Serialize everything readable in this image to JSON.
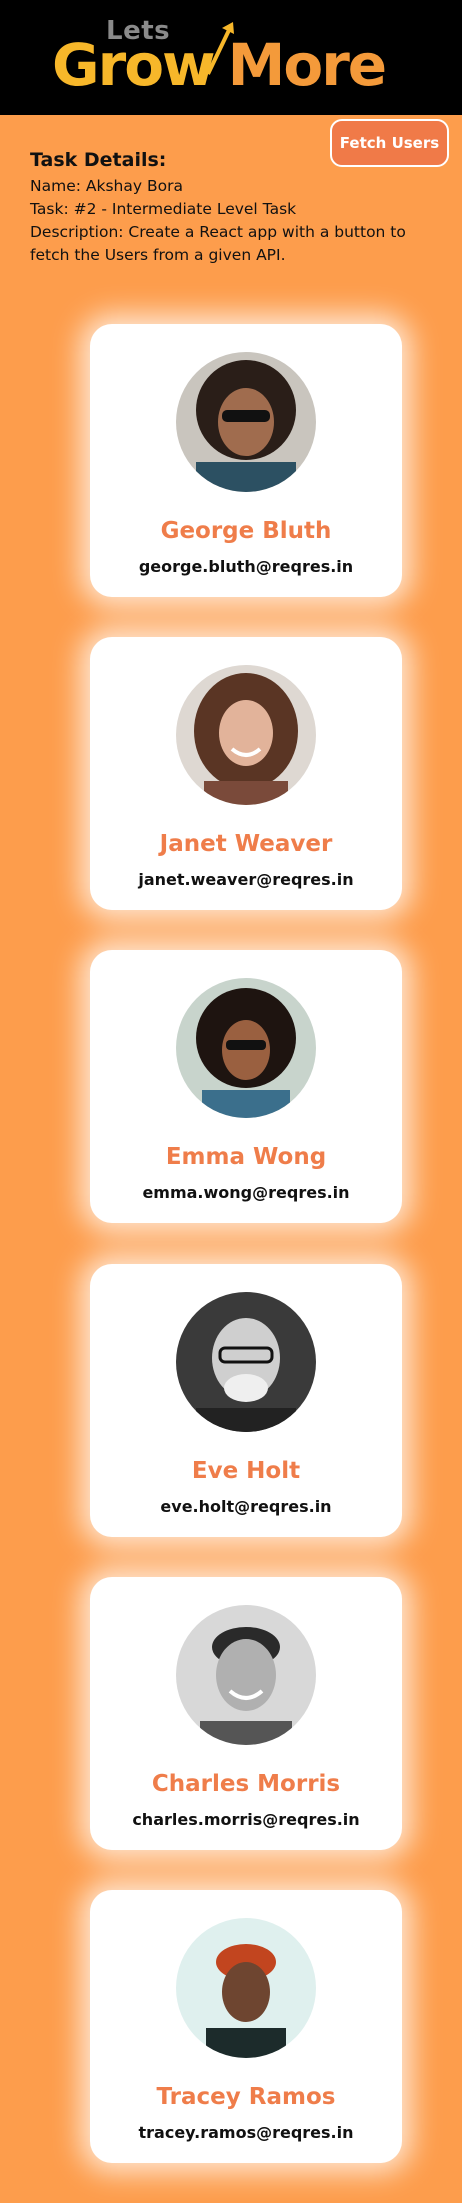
{
  "header": {
    "logo": {
      "small_word": "Lets",
      "big_word_1": "Grow",
      "big_word_2": "More"
    }
  },
  "fetch_button": {
    "label": "Fetch Users"
  },
  "task": {
    "heading": "Task Details:",
    "name_line": "Name: Akshay Bora",
    "task_line": "Task: #2 - Intermediate Level Task",
    "description_line": "Description: Create a React app with a button to fetch the Users from a given API."
  },
  "users": [
    {
      "name": "George Bluth",
      "email": "george.bluth@reqres.in"
    },
    {
      "name": "Janet Weaver",
      "email": "janet.weaver@reqres.in"
    },
    {
      "name": "Emma Wong",
      "email": "emma.wong@reqres.in"
    },
    {
      "name": "Eve Holt",
      "email": "eve.holt@reqres.in"
    },
    {
      "name": "Charles Morris",
      "email": "charles.morris@reqres.in"
    },
    {
      "name": "Tracey Ramos",
      "email": "tracey.ramos@reqres.in"
    }
  ],
  "colors": {
    "page_background": "#fd9d4c",
    "header_background": "#000000",
    "accent": "#ef7d4a",
    "button": "#f07a48",
    "logo_yellow": "#f7b72a",
    "logo_orange": "#f49a3a"
  }
}
